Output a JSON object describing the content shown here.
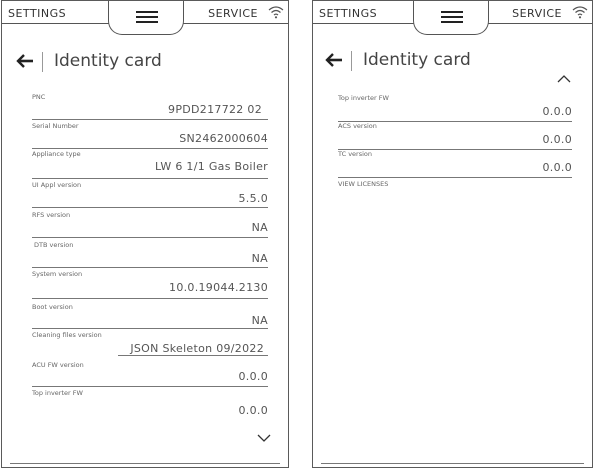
{
  "panels": [
    {
      "nav": {
        "left": "SETTINGS",
        "right": "SERVICE"
      },
      "title": "Identity card",
      "fields": [
        {
          "label": "PNC",
          "value": "9PDD217722 02"
        },
        {
          "label": "Serial Number",
          "value": "SN2462000604"
        },
        {
          "label": "Appliance type",
          "value": "LW 6 1/1 Gas Boiler"
        },
        {
          "label": "UI Appl version",
          "value": "5.5.0"
        },
        {
          "label": "RFS version",
          "value": "NA"
        },
        {
          "label": "DTB version",
          "value": "NA"
        },
        {
          "label": "System version",
          "value": "10.0.19044.2130"
        },
        {
          "label": "Boot version",
          "value": "NA"
        },
        {
          "label": "Cleaning files version",
          "value": "JSON Skeleton 09/2022"
        },
        {
          "label": "ACU FW version",
          "value": "0.0.0"
        },
        {
          "label": "Top inverter FW",
          "value": "0.0.0"
        }
      ]
    },
    {
      "nav": {
        "left": "SETTINGS",
        "right": "SERVICE"
      },
      "title": "Identity card",
      "fields": [
        {
          "label": "Top inverter FW",
          "value": "0.0.0"
        },
        {
          "label": "ACS version",
          "value": "0.0.0"
        },
        {
          "label": "TC version",
          "value": "0.0.0"
        }
      ],
      "link": "VIEW LICENSES"
    }
  ],
  "icons": [
    "menu-icon",
    "wifi-icon",
    "back-arrow-icon",
    "chevron-down-icon",
    "chevron-up-icon"
  ]
}
